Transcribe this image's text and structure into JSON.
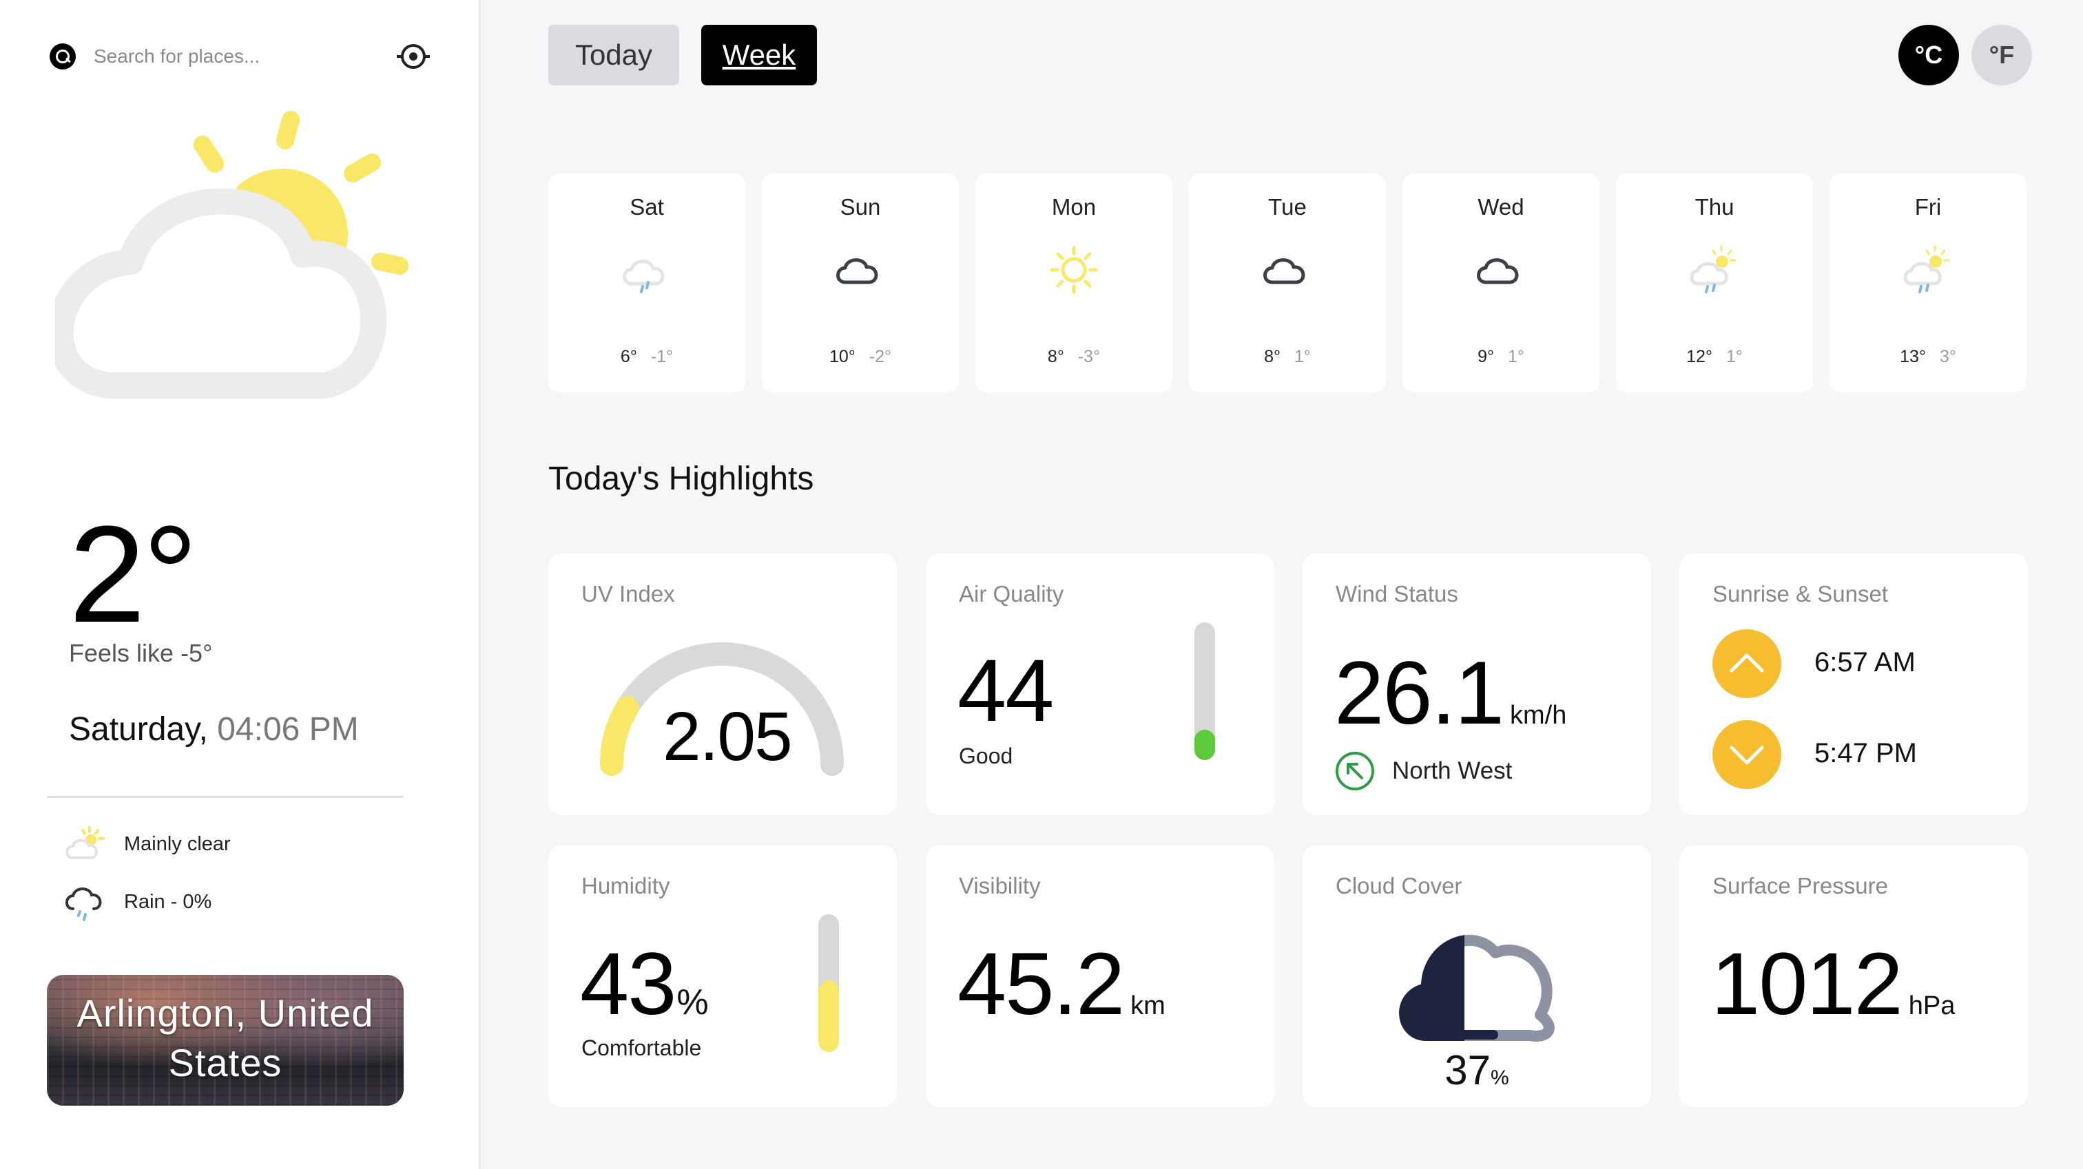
{
  "search": {
    "placeholder": "Search for places..."
  },
  "current": {
    "temperature": "2°",
    "feels_like": "Feels like -5°",
    "day": "Saturday,",
    "time": "04:06 PM",
    "conditions": [
      {
        "label": "Mainly clear",
        "icon": "sun-cloud-icon"
      },
      {
        "label": "Rain - 0%",
        "icon": "rain-cloud-icon"
      }
    ],
    "location": "Arlington, United States"
  },
  "tabs": {
    "today": "Today",
    "week": "Week",
    "active": "week"
  },
  "units": {
    "celsius": "°C",
    "fahrenheit": "°F",
    "active": "celsius"
  },
  "week": [
    {
      "day": "Sat",
      "icon": "rain-cloud-icon",
      "high": "6°",
      "low": "-1°"
    },
    {
      "day": "Sun",
      "icon": "cloud-icon",
      "high": "10°",
      "low": "-2°"
    },
    {
      "day": "Mon",
      "icon": "sun-icon",
      "high": "8°",
      "low": "-3°"
    },
    {
      "day": "Tue",
      "icon": "cloud-icon",
      "high": "8°",
      "low": "1°"
    },
    {
      "day": "Wed",
      "icon": "cloud-icon",
      "high": "9°",
      "low": "1°"
    },
    {
      "day": "Thu",
      "icon": "sun-rain-cloud-icon",
      "high": "12°",
      "low": "1°"
    },
    {
      "day": "Fri",
      "icon": "sun-rain-cloud-icon",
      "high": "13°",
      "low": "3°"
    }
  ],
  "highlights": {
    "title": "Today's Highlights",
    "uv": {
      "label": "UV Index",
      "value": "2.05",
      "fraction": 0.171
    },
    "air": {
      "label": "Air Quality",
      "value": "44",
      "status": "Good",
      "fraction": 0.22
    },
    "wind": {
      "label": "Wind Status",
      "value": "26.1",
      "unit": "km/h",
      "direction": "North West"
    },
    "sun": {
      "label": "Sunrise & Sunset",
      "sunrise": "6:57 AM",
      "sunset": "5:47 PM"
    },
    "humidity": {
      "label": "Humidity",
      "value": "43",
      "unit": "%",
      "status": "Comfortable",
      "fraction": 0.52
    },
    "visibility": {
      "label": "Visibility",
      "value": "45.2",
      "unit": "km"
    },
    "cloud": {
      "label": "Cloud Cover",
      "value": "37",
      "unit": "%"
    },
    "pressure": {
      "label": "Surface Pressure",
      "value": "1012",
      "unit": "hPa"
    }
  },
  "colors": {
    "sun": "#f9e867",
    "accent_orange": "#f5bd2f",
    "air_bar": "#5cc93a",
    "humidity_bar": "#f9e867",
    "cloud_dark": "#1e2440",
    "cloud_light": "#8e93a4",
    "wind_green": "#2e9b47"
  }
}
